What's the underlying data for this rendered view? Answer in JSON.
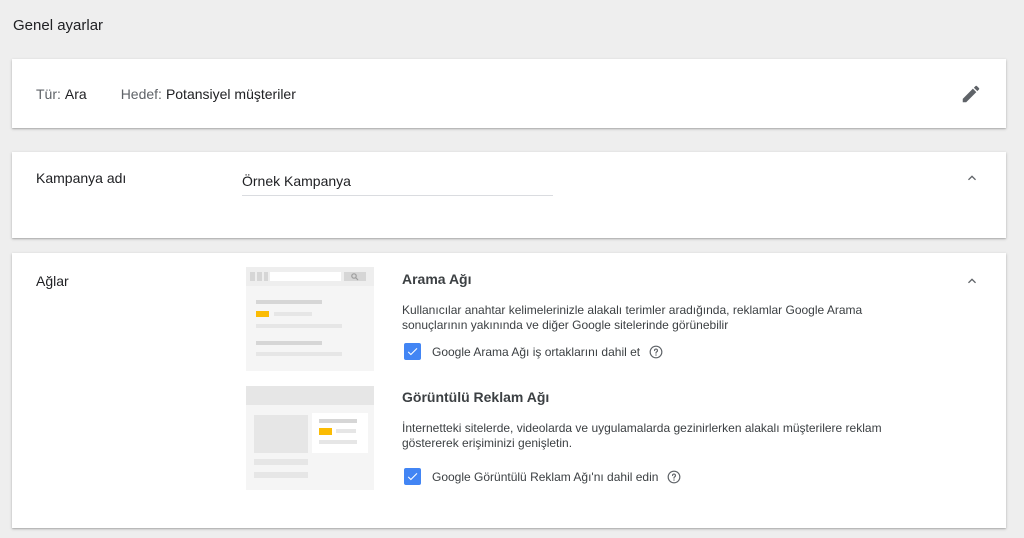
{
  "page": {
    "title": "Genel ayarlar"
  },
  "summary": {
    "type_label": "Tür:",
    "type_value": "Ara",
    "goal_label": "Hedef:",
    "goal_value": "Potansiyel müşteriler",
    "edit_icon": "pencil-icon"
  },
  "campaign_name": {
    "label": "Kampanya adı",
    "value": "Örnek Kampanya",
    "collapse_icon": "chevron-up-icon"
  },
  "networks": {
    "label": "Ağlar",
    "collapse_icon": "chevron-up-icon",
    "search": {
      "title": "Arama Ağı",
      "description": "Kullanıcılar anahtar kelimelerinizle alakalı terimler aradığında, reklamlar Google Arama sonuçlarının yakınında ve diğer Google sitelerinde görünebilir",
      "checkbox_label": "Google Arama Ağı iş ortaklarını dahil et",
      "checked": true,
      "help_icon": "help-circle-icon"
    },
    "display": {
      "title": "Görüntülü Reklam Ağı",
      "description": "İnternetteki sitelerde, videolarda ve uygulamalarda gezinirlerken alakalı müşterilere reklam göstererek erişiminizi genişletin.",
      "checkbox_label": "Google Görüntülü Reklam Ağı'nı dahil edin",
      "checked": true,
      "help_icon": "help-circle-icon"
    }
  },
  "colors": {
    "checkbox": "#4285f4",
    "ad_highlight": "#fbbc04",
    "background": "#eeeeee"
  }
}
